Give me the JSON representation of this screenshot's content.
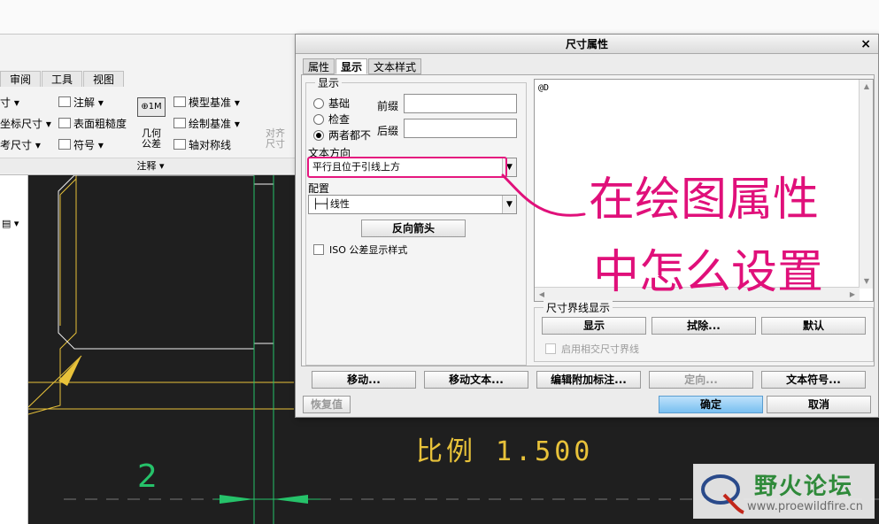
{
  "ribbon": {
    "tabs": [
      "审阅",
      "工具",
      "视图"
    ],
    "items": {
      "annotate": "注解",
      "coord_dim": "坐标尺寸",
      "ref_dim": "考尺寸",
      "surface_finish": "表面粗糙度",
      "symbol": "符号",
      "gtol_line1": "几何",
      "gtol_line2": "公差",
      "model_datum": "模型基准",
      "draw_datum": "绘制基准",
      "sym_line": "轴对称线",
      "align_line1": "对齐",
      "align_line2": "尺寸",
      "frag1": "寸"
    },
    "group_label": "注释 ▾"
  },
  "canvas": {
    "scale_text": "比例 1.500",
    "dim_value": "2"
  },
  "dialog": {
    "title": "尺寸属性",
    "close": "×",
    "tabs": [
      "属性",
      "显示",
      "文本样式"
    ],
    "display_group": "显示",
    "radio_basic": "基础",
    "radio_check": "检查",
    "radio_neither": "两者都不",
    "prefix_label": "前缀",
    "suffix_label": "后缀",
    "text_dir_label": "文本方向",
    "text_dir_value": "平行且位于引线上方",
    "config_label": "配置",
    "config_value": "├─┤线性",
    "reverse_arrow": "反向箭头",
    "iso_checkbox": "ISO 公差显示样式",
    "text_content": "@D",
    "ext_group": "尺寸界线显示",
    "ext_show": "显示",
    "ext_erase": "拭除...",
    "ext_default": "默认",
    "ext_checkbox": "启用相交尺寸界线",
    "bottom_buttons": [
      "移动...",
      "移动文本...",
      "编辑附加标注...",
      "定向...",
      "文本符号..."
    ],
    "restore": "恢复值",
    "ok": "确定",
    "cancel": "取消"
  },
  "annotation": {
    "line1": "在绘图属性",
    "line2": "中怎么设置"
  },
  "watermark": {
    "title": "野火论坛",
    "url": "www.proewildfire.cn"
  },
  "colors": {
    "canvas_bg": "#1f1f1f",
    "yellow_geom": "#e8c23a",
    "green_dim": "#26c26a",
    "annotation": "#e0107a",
    "primary_button": "#79bff0"
  }
}
